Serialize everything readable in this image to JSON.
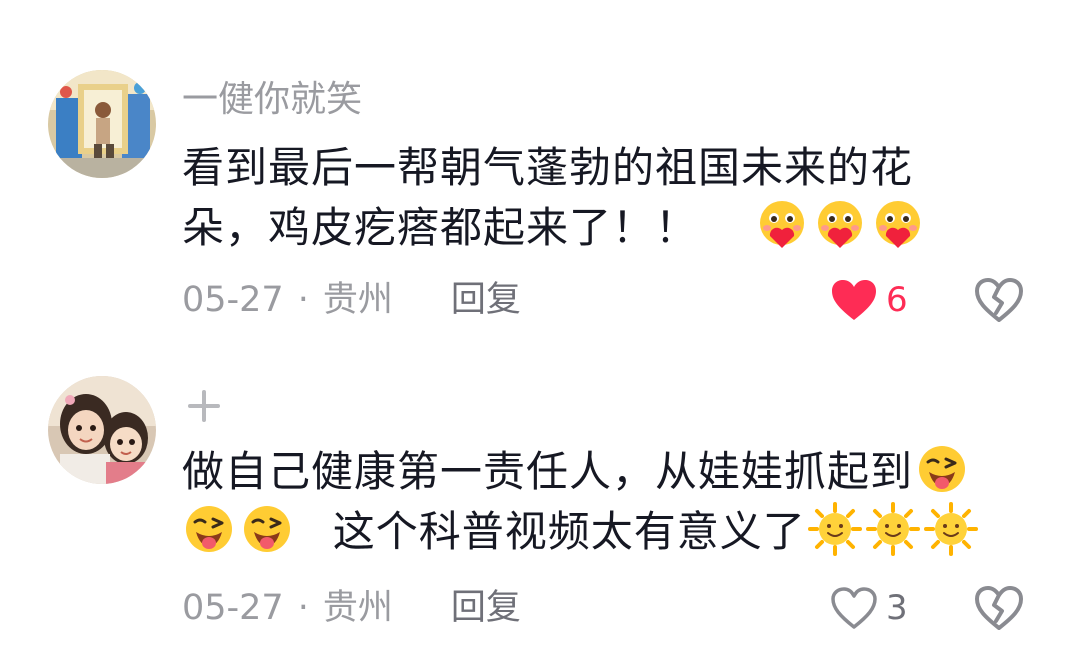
{
  "comments": [
    {
      "username": "一健你就笑",
      "text_line1": "看到最后一帮朝气蓬勃的祖国未来的花",
      "text_line2": "朵，鸡皮疙瘩都起来了！！",
      "emojis": [
        "love-face-emoji",
        "love-face-emoji",
        "love-face-emoji"
      ],
      "date": "05-27",
      "separator": "·",
      "location": "贵州",
      "reply_label": "回复",
      "like_count": "6",
      "liked": true
    },
    {
      "username_icon": "plus-icon",
      "text_part1": "做自己健康第一责任人，从娃娃抓起到",
      "text_part2": "这个科普视频太有意义了",
      "emojis_inline": [
        "wink-tongue-emoji",
        "wink-tongue-emoji",
        "wink-tongue-emoji",
        "sun-emoji",
        "sun-emoji",
        "sun-emoji"
      ],
      "date": "05-27",
      "separator": "·",
      "location": "贵州",
      "reply_label": "回复",
      "like_count": "3",
      "liked": false
    }
  ],
  "colors": {
    "text": "#161823",
    "secondary": "#9a9ba0",
    "like_red": "#fe2c55",
    "icon_gray": "#8a8b91"
  }
}
